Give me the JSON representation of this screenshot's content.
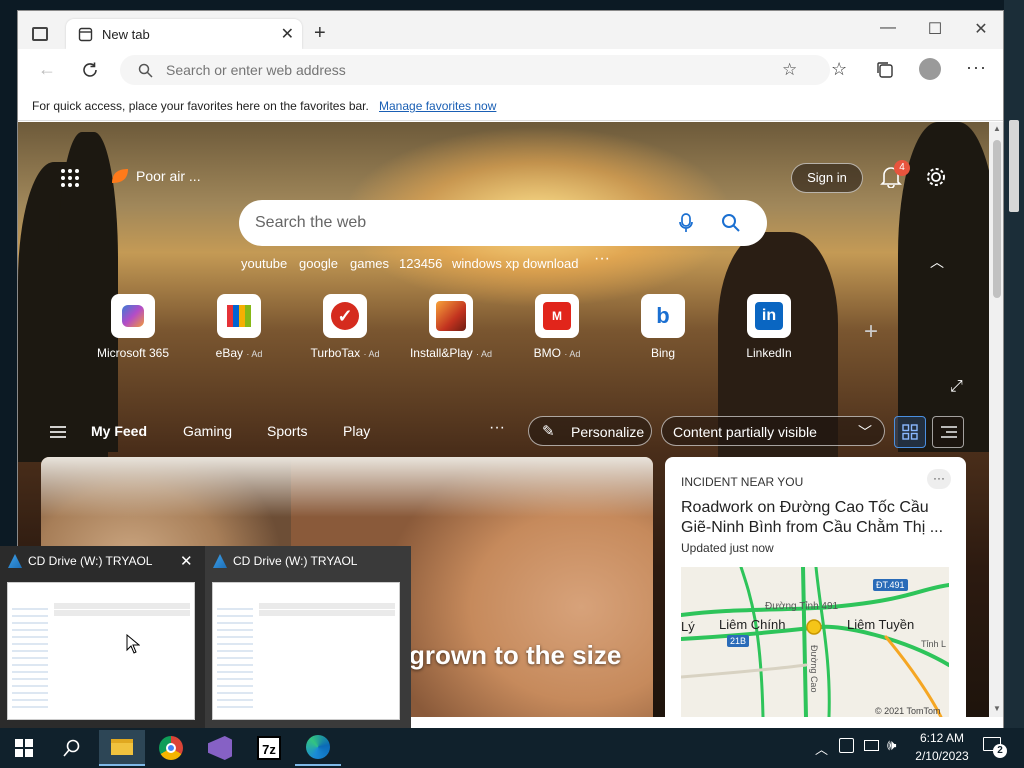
{
  "browser": {
    "tab_title": "New tab",
    "address_placeholder": "Search or enter web address",
    "favbar_text": "For quick access, place your favorites here on the favorites bar.",
    "favbar_link": "Manage favorites now"
  },
  "newtab": {
    "weather_label": "Poor air ...",
    "sign_in": "Sign in",
    "notification_count": "4",
    "search_placeholder": "Search the web",
    "trending": [
      "youtube",
      "google",
      "games",
      "123456",
      "windows xp download"
    ],
    "quick_links": [
      {
        "label": "Microsoft 365",
        "ad": ""
      },
      {
        "label": "eBay",
        "ad": "· Ad"
      },
      {
        "label": "TurboTax",
        "ad": "· Ad"
      },
      {
        "label": "Install&Play",
        "ad": "· Ad"
      },
      {
        "label": "BMO",
        "ad": "· Ad"
      },
      {
        "label": "Bing",
        "ad": ""
      },
      {
        "label": "LinkedIn",
        "ad": ""
      }
    ],
    "feed_tabs": [
      "My Feed",
      "Gaming",
      "Sports",
      "Play"
    ],
    "personalize": "Personalize",
    "content_visibility": "Content partially visible",
    "main_headline_fragment": "grown to the size",
    "incident": {
      "kicker": "INCIDENT NEAR YOU",
      "title": "Roadwork on Đường Cao Tốc Cầu Giẽ-Ninh Bình from Cầu Chằm Thị ...",
      "updated": "Updated just now",
      "map_labels": [
        "ĐT.491",
        "Đường Tỉnh 491",
        "Liêm Chính",
        "Liêm Tuyền",
        "Lý",
        "21B",
        "Đường Cao",
        "Tỉnh L"
      ],
      "map_copyright": "© 2021 TomTom"
    }
  },
  "thumbnails": [
    {
      "title": "CD Drive (W:) TRYAOL"
    },
    {
      "title": "CD Drive (W:) TRYAOL"
    }
  ],
  "taskbar": {
    "time": "6:12 AM",
    "date": "2/10/2023",
    "notification_count": "2",
    "apps": [
      "start-icon",
      "search-icon",
      "file-explorer-icon",
      "chrome-icon",
      "visual-studio-icon",
      "7zip-icon",
      "edge-icon"
    ]
  }
}
